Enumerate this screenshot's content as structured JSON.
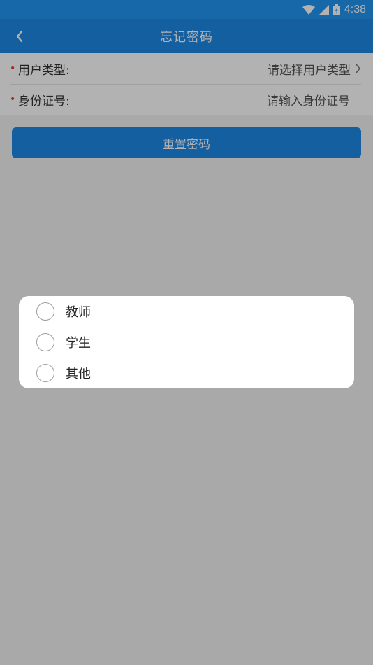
{
  "status_bar": {
    "time": "4:38",
    "icons": [
      "wifi-icon",
      "signal-icon",
      "battery-icon"
    ]
  },
  "app_bar": {
    "title": "忘记密码",
    "back_icon": "chevron-left-icon"
  },
  "form": {
    "rows": [
      {
        "label": "用户类型:",
        "value": "请选择用户类型",
        "required": true,
        "type": "select"
      },
      {
        "label": "身份证号:",
        "placeholder": "请输入身份证号",
        "required": true,
        "type": "input"
      }
    ]
  },
  "reset_button": {
    "label": "重置密码"
  },
  "dialog": {
    "options": [
      {
        "label": "教师",
        "selected": false
      },
      {
        "label": "学生",
        "selected": false
      },
      {
        "label": "其他",
        "selected": false
      }
    ]
  },
  "colors": {
    "primary": "#1e88e5",
    "status_bar": "#2196f3",
    "required": "#e53935",
    "overlay": "rgba(0,0,0,0.3)"
  }
}
